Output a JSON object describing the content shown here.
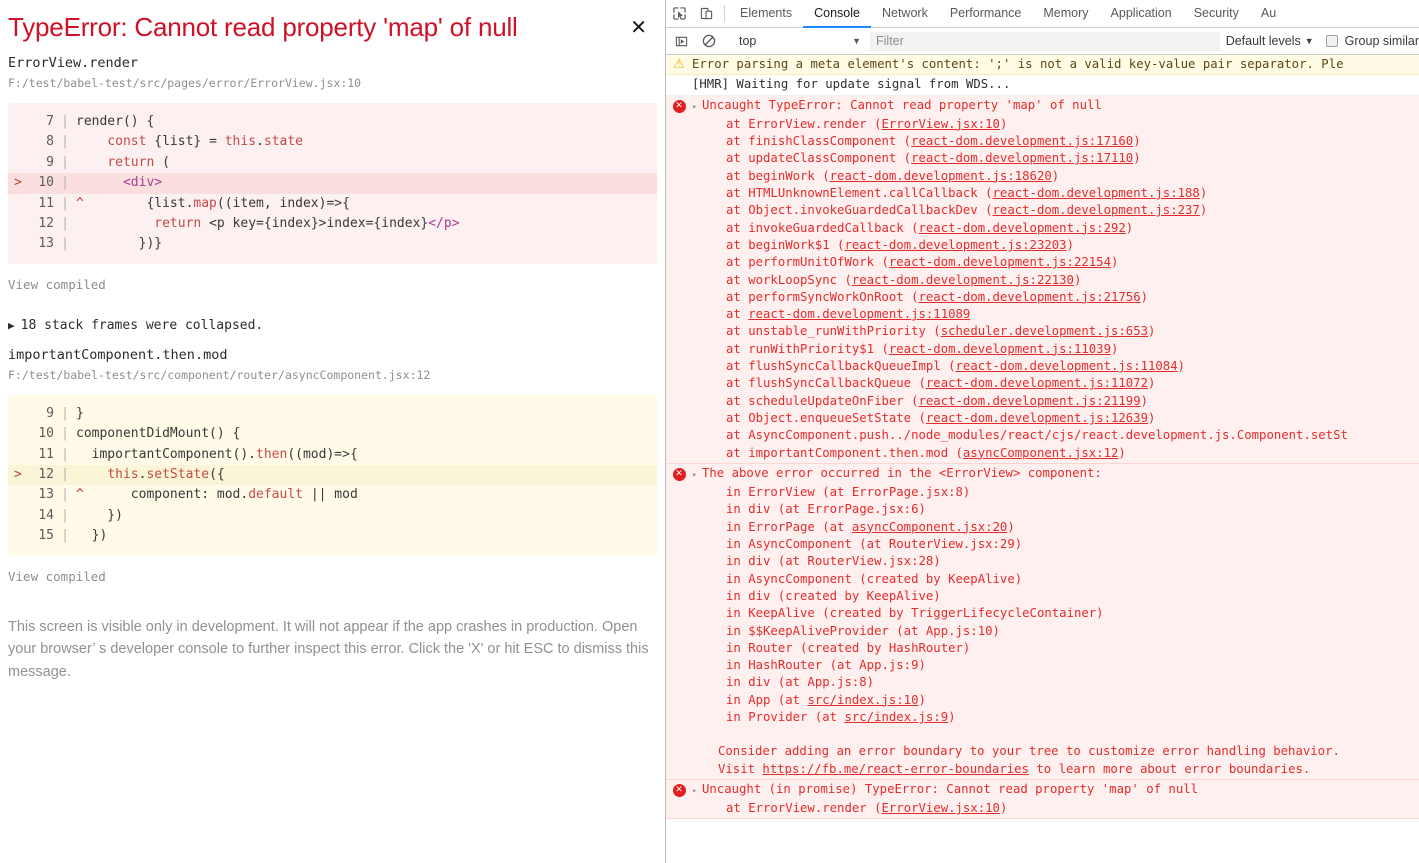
{
  "overlay": {
    "title": "TypeError: Cannot read property 'map' of null",
    "close_label": "✕",
    "frames": [
      {
        "fn": "ErrorView.render",
        "loc": "F:/test/babel-test/src/pages/error/ErrorView.jsx:10",
        "kind": "err",
        "view_compiled": "View compiled",
        "lines": [
          {
            "mark": "",
            "num": "7",
            "code": "render() {",
            "hl": false
          },
          {
            "mark": "",
            "num": "8",
            "code": "    const {list} = this.state",
            "hl": false
          },
          {
            "mark": "",
            "num": "9",
            "code": "    return (",
            "hl": false
          },
          {
            "mark": ">",
            "num": "10",
            "code": "      <div>",
            "hl": true
          },
          {
            "mark": "",
            "num": "11",
            "code": "^        {list.map((item, index)=>{",
            "hl": false
          },
          {
            "mark": "",
            "num": "12",
            "code": "          return <p key={index}>index={index}</p>",
            "hl": false
          },
          {
            "mark": "",
            "num": "13",
            "code": "        })}",
            "hl": false
          }
        ]
      },
      {
        "fn": "importantComponent.then.mod",
        "loc": "F:/test/babel-test/src/component/router/asyncComponent.jsx:12",
        "kind": "warn",
        "view_compiled": "View compiled",
        "lines": [
          {
            "mark": "",
            "num": "9",
            "code": "}",
            "hl": false
          },
          {
            "mark": "",
            "num": "10",
            "code": "componentDidMount() {",
            "hl": false
          },
          {
            "mark": "",
            "num": "11",
            "code": "  importantComponent().then((mod)=>{",
            "hl": false
          },
          {
            "mark": ">",
            "num": "12",
            "code": "    this.setState({",
            "hl": true
          },
          {
            "mark": "",
            "num": "13",
            "code": "^      component: mod.default || mod",
            "hl": false
          },
          {
            "mark": "",
            "num": "14",
            "code": "    })",
            "hl": false
          },
          {
            "mark": "",
            "num": "15",
            "code": "  })",
            "hl": false
          }
        ]
      }
    ],
    "collapsed_frames": "18 stack frames were collapsed.",
    "collapsed_triangle": "▶",
    "footer": "This screen is visible only in development. It will not appear if the app crashes in production. Open your browser’  s developer console to further inspect this error.  Click the 'X' or hit ESC to dismiss this message."
  },
  "devtools": {
    "icons": {
      "inspect": "inspect-element-icon",
      "device": "device-toolbar-icon",
      "sidebar": "console-sidebar-icon",
      "clear": "clear-console-icon"
    },
    "tabs": [
      {
        "label": "Elements",
        "active": false
      },
      {
        "label": "Console",
        "active": true
      },
      {
        "label": "Network",
        "active": false
      },
      {
        "label": "Performance",
        "active": false
      },
      {
        "label": "Memory",
        "active": false
      },
      {
        "label": "Application",
        "active": false
      },
      {
        "label": "Security",
        "active": false
      },
      {
        "label": "Au",
        "active": false
      }
    ],
    "filterbar": {
      "context": "top",
      "context_caret": "▼",
      "filter_placeholder": "Filter",
      "filter_value": "",
      "levels": "Default levels",
      "levels_caret": "▼",
      "group_similar": "Group similar",
      "group_similar_checked": false
    },
    "messages": [
      {
        "type": "warning",
        "badge": "⚠",
        "expandable": false,
        "lines": [
          {
            "text": "Error parsing a meta element's content: ';' is not a valid key-value pair separator. Ple",
            "indent": 0
          }
        ]
      },
      {
        "type": "info",
        "badge": "",
        "expandable": false,
        "lines": [
          {
            "text": "[HMR] Waiting for update signal from WDS...",
            "indent": 0
          }
        ]
      },
      {
        "type": "error",
        "badge": "✕",
        "expandable": true,
        "lines": [
          {
            "text": "Uncaught TypeError: Cannot read property 'map' of null",
            "indent": 0
          },
          {
            "text": "at ErrorView.render (ErrorView.jsx:10)",
            "indent": 1
          },
          {
            "text": "at finishClassComponent (react-dom.development.js:17160)",
            "indent": 1
          },
          {
            "text": "at updateClassComponent (react-dom.development.js:17110)",
            "indent": 1
          },
          {
            "text": "at beginWork (react-dom.development.js:18620)",
            "indent": 1
          },
          {
            "text": "at HTMLUnknownElement.callCallback (react-dom.development.js:188)",
            "indent": 1
          },
          {
            "text": "at Object.invokeGuardedCallbackDev (react-dom.development.js:237)",
            "indent": 1
          },
          {
            "text": "at invokeGuardedCallback (react-dom.development.js:292)",
            "indent": 1
          },
          {
            "text": "at beginWork$1 (react-dom.development.js:23203)",
            "indent": 1
          },
          {
            "text": "at performUnitOfWork (react-dom.development.js:22154)",
            "indent": 1
          },
          {
            "text": "at workLoopSync (react-dom.development.js:22130)",
            "indent": 1
          },
          {
            "text": "at performSyncWorkOnRoot (react-dom.development.js:21756)",
            "indent": 1
          },
          {
            "text": "at react-dom.development.js:11089",
            "indent": 1
          },
          {
            "text": "at unstable_runWithPriority (scheduler.development.js:653)",
            "indent": 1
          },
          {
            "text": "at runWithPriority$1 (react-dom.development.js:11039)",
            "indent": 1
          },
          {
            "text": "at flushSyncCallbackQueueImpl (react-dom.development.js:11084)",
            "indent": 1
          },
          {
            "text": "at flushSyncCallbackQueue (react-dom.development.js:11072)",
            "indent": 1
          },
          {
            "text": "at scheduleUpdateOnFiber (react-dom.development.js:21199)",
            "indent": 1
          },
          {
            "text": "at Object.enqueueSetState (react-dom.development.js:12639)",
            "indent": 1
          },
          {
            "text": "at AsyncComponent.push../node_modules/react/cjs/react.development.js.Component.setSt",
            "indent": 1
          },
          {
            "text": "at importantComponent.then.mod (asyncComponent.jsx:12)",
            "indent": 1
          }
        ]
      },
      {
        "type": "error",
        "badge": "✕",
        "expandable": true,
        "lines": [
          {
            "text": "The above error occurred in the <ErrorView> component:",
            "indent": 0
          },
          {
            "text": "in ErrorView (at ErrorPage.jsx:8)",
            "indent": 1
          },
          {
            "text": "in div (at ErrorPage.jsx:6)",
            "indent": 1
          },
          {
            "text": "in ErrorPage (at asyncComponent.jsx:20)",
            "indent": 1
          },
          {
            "text": "in AsyncComponent (at RouterView.jsx:29)",
            "indent": 1
          },
          {
            "text": "in div (at RouterView.jsx:28)",
            "indent": 1
          },
          {
            "text": "in AsyncComponent (created by KeepAlive)",
            "indent": 1
          },
          {
            "text": "in div (created by KeepAlive)",
            "indent": 1
          },
          {
            "text": "in KeepAlive (created by TriggerLifecycleContainer)",
            "indent": 1
          },
          {
            "text": "in $$KeepAliveProvider (at App.js:10)",
            "indent": 1
          },
          {
            "text": "in Router (created by HashRouter)",
            "indent": 1
          },
          {
            "text": "in HashRouter (at App.js:9)",
            "indent": 1
          },
          {
            "text": "in div (at App.js:8)",
            "indent": 1
          },
          {
            "text": "in App (at src/index.js:10)",
            "indent": 1
          },
          {
            "text": "in Provider (at src/index.js:9)",
            "indent": 1
          },
          {
            "text": "",
            "indent": 1
          },
          {
            "text": "Consider adding an error boundary to your tree to customize error handling behavior.",
            "indent": 2
          },
          {
            "text": "Visit https://fb.me/react-error-boundaries to learn more about error boundaries.",
            "indent": 2
          }
        ]
      },
      {
        "type": "error",
        "badge": "✕",
        "expandable": true,
        "lines": [
          {
            "text": "Uncaught (in promise) TypeError: Cannot read property 'map' of null",
            "indent": 0
          },
          {
            "text": "at ErrorView.render (ErrorView.jsx:10)",
            "indent": 1
          }
        ]
      }
    ]
  }
}
